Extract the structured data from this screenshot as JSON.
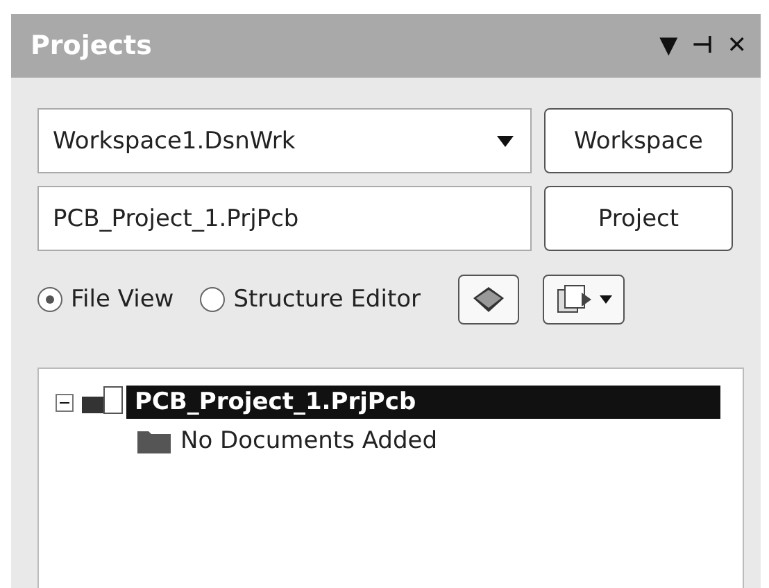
{
  "panel": {
    "title": "Projects",
    "controls": [
      "▼",
      "⊣",
      "✕"
    ]
  },
  "workspace": {
    "value": "Workspace1.DsnWrk",
    "button": "Workspace"
  },
  "project": {
    "value": "PCB_Project_1.PrjPcb",
    "button": "Project"
  },
  "views": [
    {
      "label": "File View",
      "selected": true
    },
    {
      "label": "Structure Editor",
      "selected": false
    }
  ],
  "tree": [
    {
      "label": "PCB_Project_1.PrjPcb",
      "expanded": true,
      "selected": true,
      "children": [
        {
          "label": "No Documents Added",
          "selected": false
        }
      ]
    }
  ]
}
